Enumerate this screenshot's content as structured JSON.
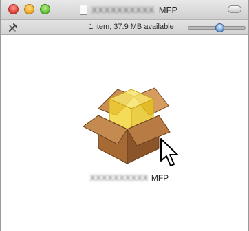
{
  "window": {
    "title_prefix": "XXXXXXXXXX",
    "title_suffix": "MFP"
  },
  "traffic_lights": [
    "close",
    "minimize",
    "zoom"
  ],
  "toolbar": {
    "status_text": "1 item, 37.9 MB available",
    "icon_size_slider_value": 0.55
  },
  "item": {
    "name_prefix": "XXXXXXXXXX",
    "name_suffix": "MFP",
    "icon": "package-icon"
  },
  "colors": {
    "box_brown": "#a66a35",
    "box_yellow": "#f1d22e"
  }
}
